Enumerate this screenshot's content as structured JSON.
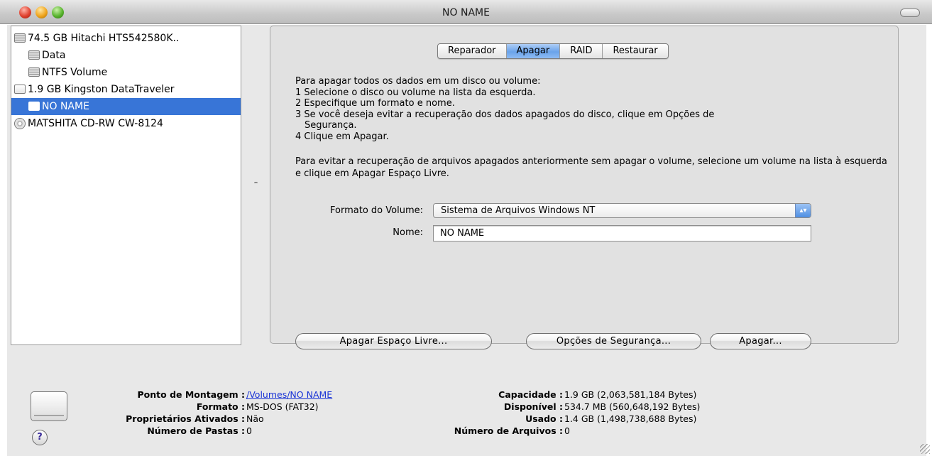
{
  "window": {
    "title": "NO NAME"
  },
  "sidebar": {
    "items": [
      {
        "label": "74.5 GB Hitachi HTS542580K..",
        "icon": "hard-drive-icon"
      },
      {
        "label": "Data",
        "icon": "volume-icon"
      },
      {
        "label": "NTFS Volume",
        "icon": "volume-icon"
      },
      {
        "label": "1.9 GB Kingston DataTraveler",
        "icon": "usb-drive-icon"
      },
      {
        "label": "NO NAME",
        "icon": "usb-volume-icon",
        "selected": true
      },
      {
        "label": "MATSHITA CD-RW CW-8124",
        "icon": "cd-drive-icon"
      }
    ]
  },
  "tabs": [
    {
      "label": "Reparador"
    },
    {
      "label": "Apagar",
      "active": true
    },
    {
      "label": "RAID"
    },
    {
      "label": "Restaurar"
    }
  ],
  "instructions": {
    "line0": "Para apagar todos os dados em um disco ou volume:",
    "line1": "1 Selecione o disco ou volume na lista da esquerda.",
    "line2": "2 Especifique um formato e nome.",
    "line3": "3 Se você deseja evitar a recuperação dos dados apagados do disco, clique em Opções de",
    "line3b": "Segurança.",
    "line4": "4 Clique em Apagar.",
    "note": "Para evitar a recuperação de arquivos apagados anteriormente sem apagar o volume, selecione um volume na lista à esquerda e clique em Apagar Espaço Livre."
  },
  "form": {
    "format_label": "Formato do Volume:",
    "format_value": "Sistema de Arquivos Windows NT",
    "name_label": "Nome:",
    "name_value": "NO NAME"
  },
  "buttons": {
    "erase_free_space": "Apagar Espaço Livre...",
    "security_options": "Opções de Segurança...",
    "erase": "Apagar..."
  },
  "info": {
    "mount_point_key": "Ponto de Montagem :",
    "mount_point_val": "/Volumes/NO NAME",
    "format_key": "Formato :",
    "format_val": "MS-DOS (FAT32)",
    "owners_key": "Proprietários Ativados :",
    "owners_val": "Não",
    "folders_key": "Número de Pastas :",
    "folders_val": "0",
    "capacity_key": "Capacidade :",
    "capacity_val": "1.9 GB (2,063,581,184 Bytes)",
    "available_key": "Disponível :",
    "available_val": "534.7 MB (560,648,192 Bytes)",
    "used_key": "Usado :",
    "used_val": "1.4 GB (1,498,738,688 Bytes)",
    "files_key": "Número de Arquivos :",
    "files_val": "0"
  },
  "help": {
    "label": "?"
  },
  "colors": {
    "selection": "#3875d7",
    "link": "#1a34d6",
    "active_tab": "#6aa3ea"
  }
}
